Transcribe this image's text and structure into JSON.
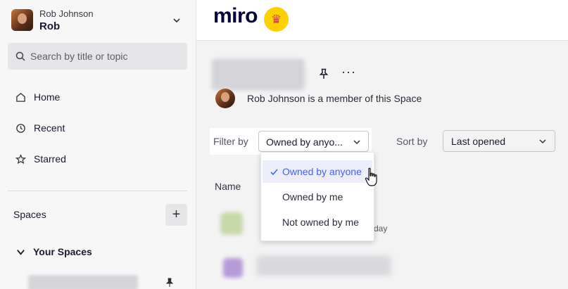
{
  "sidebar": {
    "user": {
      "org": "Rob Johnson",
      "name": "Rob"
    },
    "search": {
      "placeholder": "Search by title or topic"
    },
    "nav": [
      {
        "label": "Home",
        "icon": "home-icon"
      },
      {
        "label": "Recent",
        "icon": "clock-icon"
      },
      {
        "label": "Starred",
        "icon": "star-icon"
      }
    ],
    "spaces_label": "Spaces",
    "add_space_symbol": "+",
    "your_spaces_label": "Your Spaces"
  },
  "header": {
    "logo_text": "miro",
    "badge_icon": "crown-icon"
  },
  "space": {
    "more_symbol": "···",
    "member_text": "Rob Johnson is a member of this Space"
  },
  "filter": {
    "label": "Filter by",
    "selected": "Owned by anyo...",
    "options": [
      {
        "label": "Owned by anyone",
        "selected": true
      },
      {
        "label": "Owned by me",
        "selected": false
      },
      {
        "label": "Not owned by me",
        "selected": false
      }
    ]
  },
  "sort": {
    "label": "Sort by",
    "selected": "Last opened"
  },
  "table": {
    "name_header": "Name",
    "row_time_fragment": "day"
  },
  "colors": {
    "accent": "#4262ff",
    "brand_yellow": "#fdd000",
    "sidebar_bg": "#f7f7f8"
  }
}
